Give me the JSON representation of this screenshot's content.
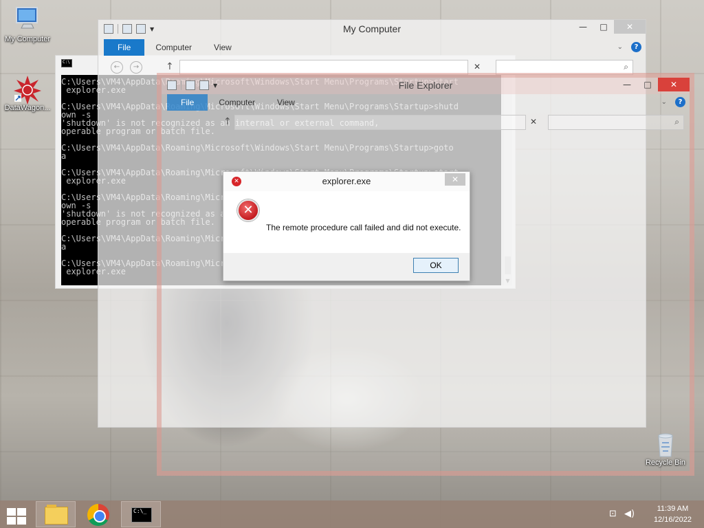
{
  "desktop": {
    "icons": [
      {
        "label": "My Computer"
      },
      {
        "label": "DataWagon..."
      },
      {
        "label": "Recycle Bin"
      }
    ]
  },
  "cmd": {
    "lines": [
      "C:\\Users\\VM4\\AppData\\Roaming\\Microsoft\\Windows\\Start Menu\\Programs\\Startup>start",
      " explorer.exe",
      "",
      "C:\\Users\\VM4\\AppData\\Roaming\\Microsoft\\Windows\\Start Menu\\Programs\\Startup>shutd",
      "own -s",
      "'shutdown' is not recognized as an internal or external command,",
      "operable program or batch file.",
      "",
      "C:\\Users\\VM4\\AppData\\Roaming\\Microsoft\\Windows\\Start Menu\\Programs\\Startup>goto",
      "a",
      "",
      "C:\\Users\\VM4\\AppData\\Roaming\\Microsoft\\Windows\\Start Menu\\Programs\\Startup>start",
      " explorer.exe",
      "",
      "C:\\Users\\VM4\\AppData\\Roaming\\Microsoft\\Windows\\Start Menu\\Programs\\Startup>shutd",
      "own -s",
      "'shutdown' is not recognized as an internal or external command,",
      "operable program or batch file.",
      "",
      "C:\\Users\\VM4\\AppData\\Roaming\\Microsoft\\Windows\\Start Menu\\Programs\\Startup>goto",
      "a",
      "",
      "C:\\Users\\VM4\\AppData\\Roaming\\Microsoft\\Windows\\Start Menu\\Programs\\Startup>start",
      " explorer.exe"
    ]
  },
  "mycomputer": {
    "title": "My Computer",
    "tabs": {
      "file": "File",
      "computer": "Computer",
      "view": "View"
    }
  },
  "fileexplorer": {
    "title": "File Explorer",
    "tabs": {
      "file": "File",
      "computer": "Computer",
      "view": "View"
    }
  },
  "dialog": {
    "title": "explorer.exe",
    "message": "The remote procedure call failed and did not execute.",
    "ok_label": "OK"
  },
  "taskbar": {
    "time": "11:39 AM",
    "date": "12/16/2022"
  },
  "colors": {
    "file_tab": "#1979ca",
    "error_red": "#d7262a",
    "close_red": "#d9413b",
    "taskbar": "#968073"
  }
}
